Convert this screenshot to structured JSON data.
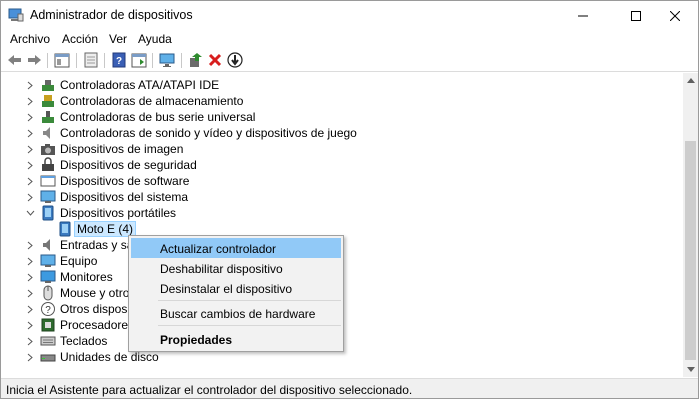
{
  "window": {
    "title": "Administrador de dispositivos",
    "controls": [
      "minimize",
      "maximize",
      "close"
    ]
  },
  "menubar": [
    "Archivo",
    "Acción",
    "Ver",
    "Ayuda"
  ],
  "toolbar": [
    "back-icon",
    "forward-icon",
    "properties-pane-icon",
    "show-hide-icon",
    "help-icon",
    "console-icon",
    "monitor-icon",
    "add-driver-icon",
    "uninstall-icon",
    "update-icon"
  ],
  "tree": [
    {
      "label": "Controladoras ATA/ATAPI IDE",
      "expanded": false,
      "icon": "ide-controller-icon"
    },
    {
      "label": "Controladoras de almacenamiento",
      "expanded": false,
      "icon": "storage-controller-icon"
    },
    {
      "label": "Controladoras de bus serie universal",
      "expanded": false,
      "icon": "usb-controller-icon"
    },
    {
      "label": "Controladoras de sonido y vídeo y dispositivos de juego",
      "expanded": false,
      "icon": "sound-icon"
    },
    {
      "label": "Dispositivos de imagen",
      "expanded": false,
      "icon": "camera-icon"
    },
    {
      "label": "Dispositivos de seguridad",
      "expanded": false,
      "icon": "security-icon"
    },
    {
      "label": "Dispositivos de software",
      "expanded": false,
      "icon": "software-device-icon"
    },
    {
      "label": "Dispositivos del sistema",
      "expanded": false,
      "icon": "system-device-icon"
    },
    {
      "label": "Dispositivos portátiles",
      "expanded": true,
      "icon": "portable-device-icon"
    },
    {
      "label": "Moto E (4)",
      "child": true,
      "selected": true,
      "icon": "phone-icon"
    },
    {
      "label": "Entradas y sali",
      "expanded": false,
      "icon": "audio-input-icon"
    },
    {
      "label": "Equipo",
      "expanded": false,
      "icon": "computer-icon"
    },
    {
      "label": "Monitores",
      "expanded": false,
      "icon": "monitor-icon"
    },
    {
      "label": "Mouse y otros",
      "expanded": false,
      "icon": "mouse-icon"
    },
    {
      "label": "Otros dispositi",
      "expanded": false,
      "icon": "other-device-icon"
    },
    {
      "label": "Procesadores",
      "expanded": false,
      "icon": "processor-icon"
    },
    {
      "label": "Teclados",
      "expanded": false,
      "icon": "keyboard-icon"
    },
    {
      "label": "Unidades de disco",
      "expanded": false,
      "icon": "disk-drive-icon"
    }
  ],
  "context_menu": {
    "items": [
      {
        "label": "Actualizar controlador",
        "highlighted": true
      },
      {
        "label": "Deshabilitar dispositivo"
      },
      {
        "label": "Desinstalar el dispositivo"
      },
      {
        "label": "Buscar cambios de hardware"
      },
      {
        "label": "Propiedades",
        "bold": true
      }
    ]
  },
  "status": {
    "text": "Inicia el Asistente para actualizar el controlador del dispositivo seleccionado."
  },
  "colors": {
    "selection_bg": "#cce8ff",
    "menu_highlight": "#91c9f7",
    "uninstall_red": "#d81e1e",
    "add_green": "#2e8b2e"
  }
}
